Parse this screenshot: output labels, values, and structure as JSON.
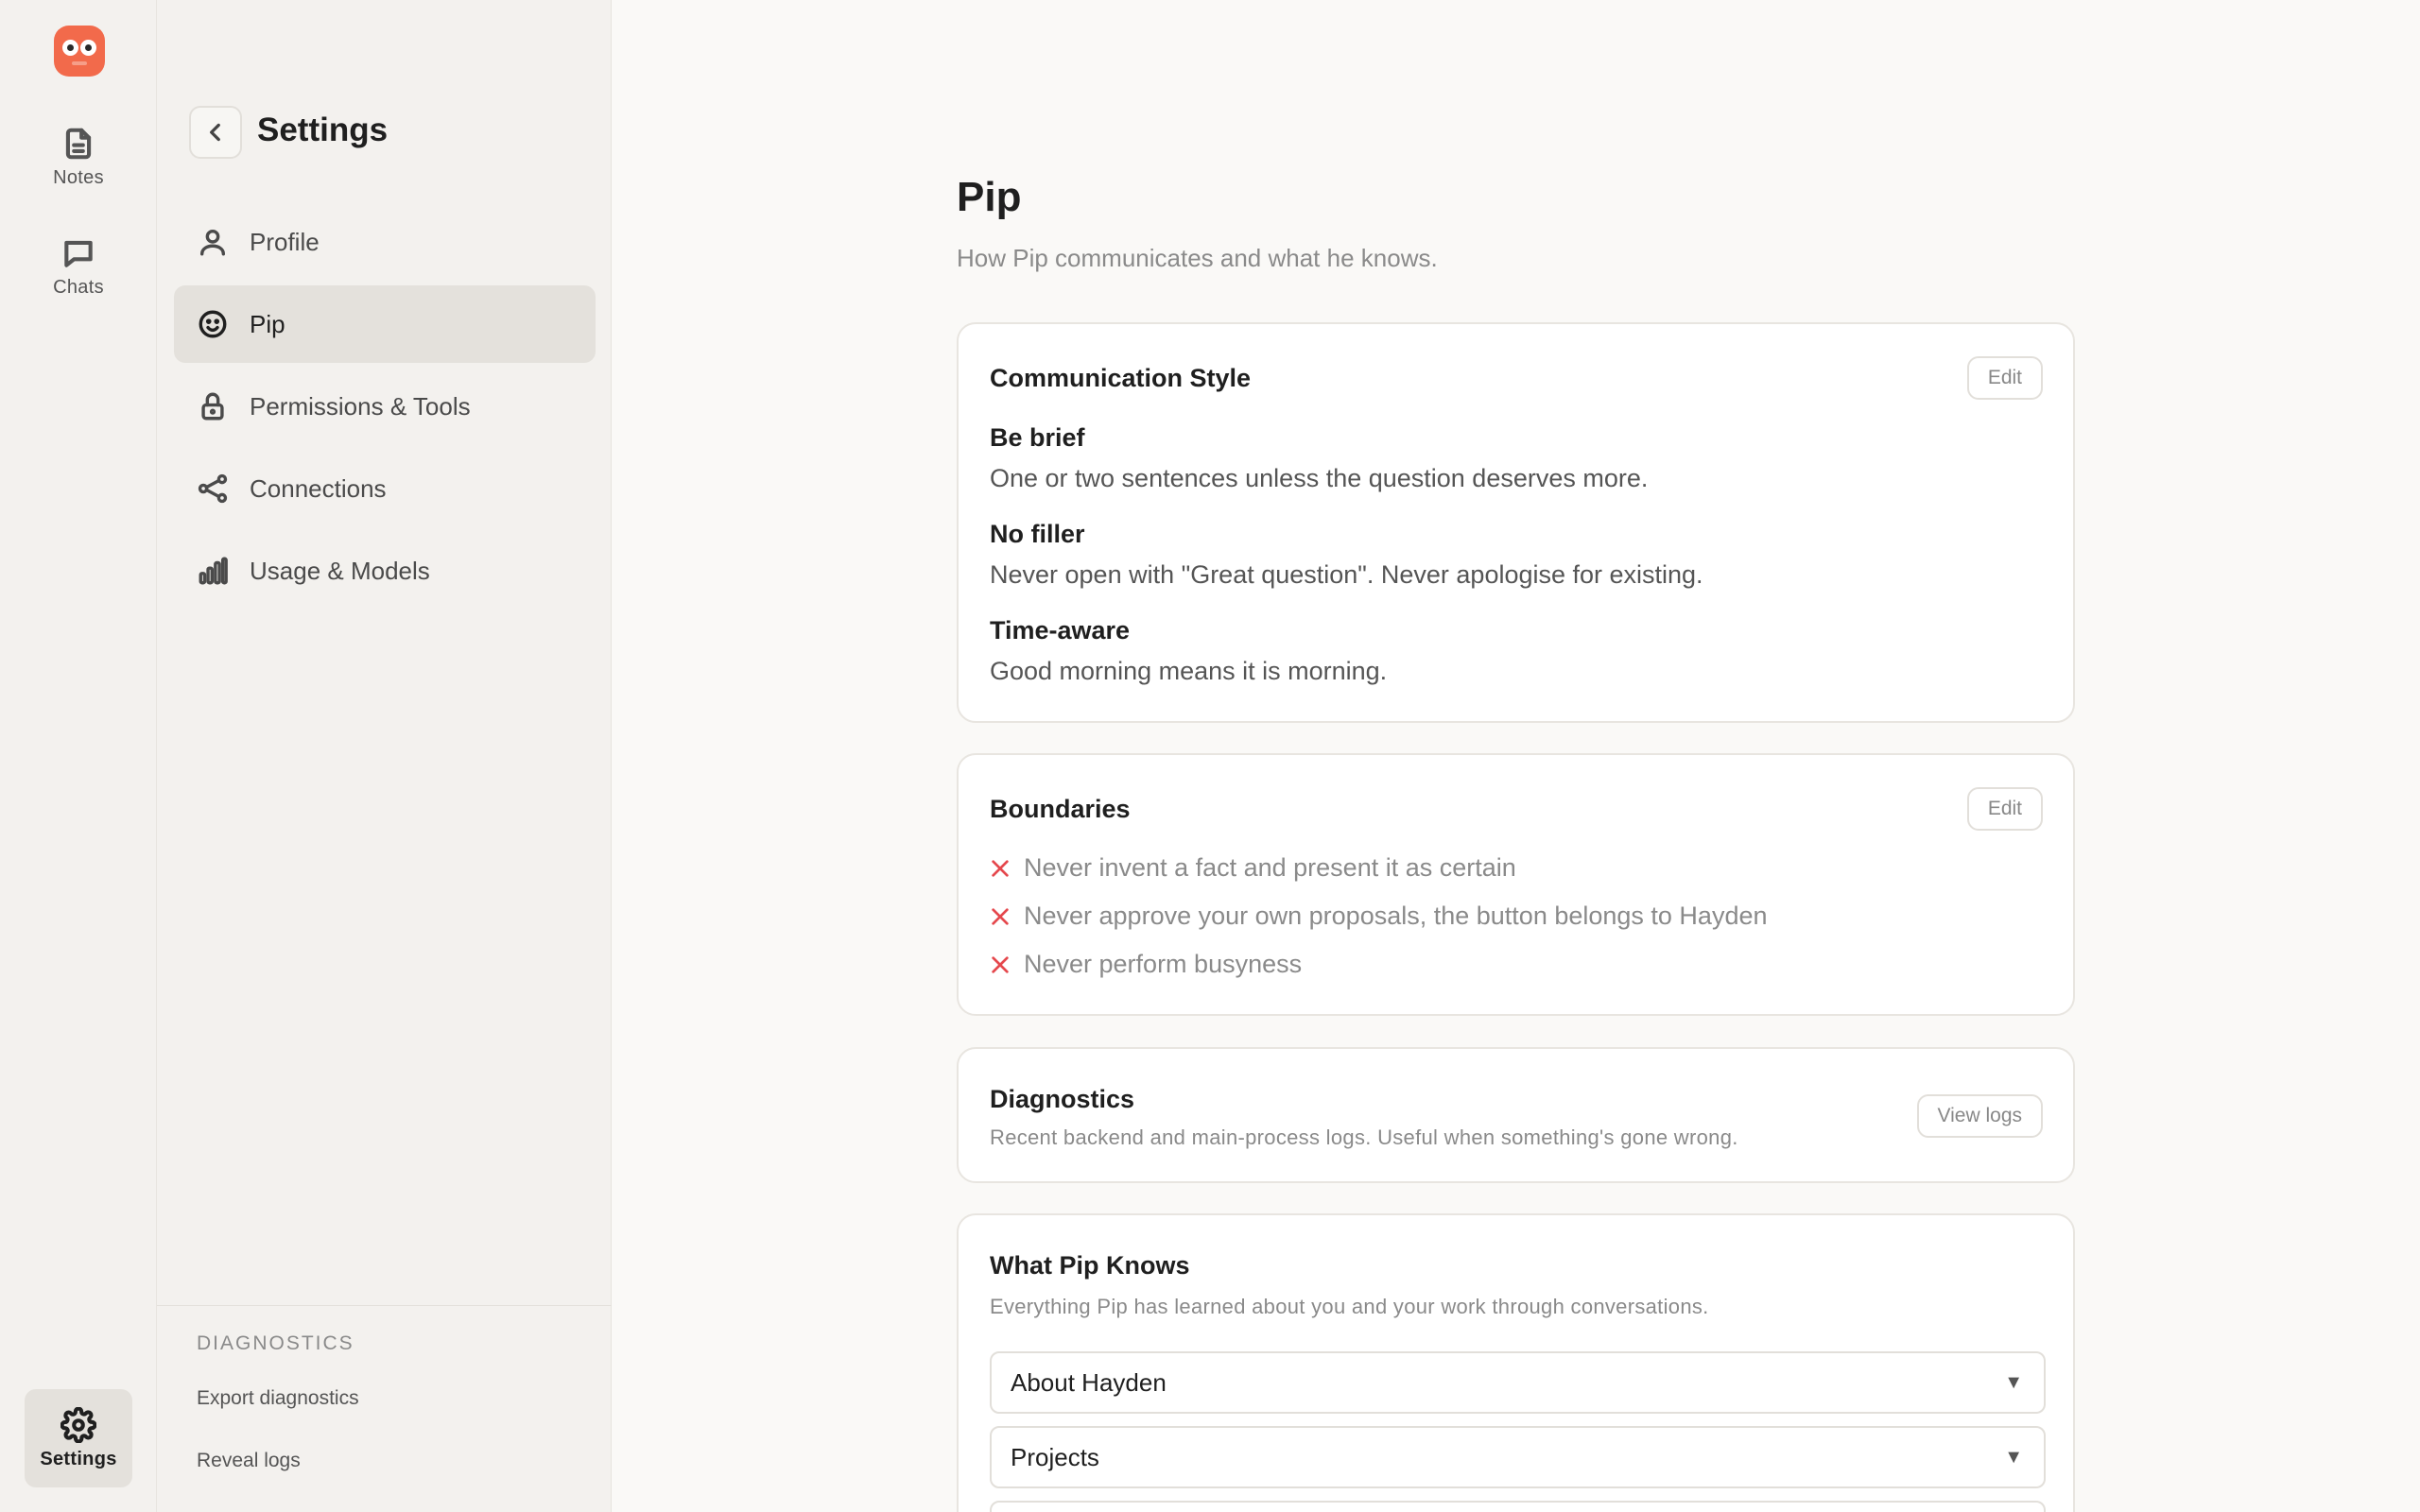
{
  "rail": {
    "items": [
      {
        "label": "Notes",
        "icon": "document-icon"
      },
      {
        "label": "Chats",
        "icon": "chat-bubble-icon"
      },
      {
        "label": "Settings",
        "icon": "gear-icon"
      }
    ],
    "logo_color": "#f26a4b"
  },
  "sidebar": {
    "title": "Settings",
    "items": [
      {
        "label": "Profile",
        "icon": "person-icon",
        "active": false
      },
      {
        "label": "Pip",
        "icon": "smiley-icon",
        "active": true
      },
      {
        "label": "Permissions & Tools",
        "icon": "lock-icon",
        "active": false
      },
      {
        "label": "Connections",
        "icon": "share-nodes-icon",
        "active": false
      },
      {
        "label": "Usage & Models",
        "icon": "bar-chart-icon",
        "active": false
      }
    ],
    "diagnostics": {
      "heading": "DIAGNOSTICS",
      "export": "Export diagnostics",
      "reveal": "Reveal logs"
    }
  },
  "main": {
    "title": "Pip",
    "subtitle": "How Pip communicates and what he knows.",
    "communication": {
      "title": "Communication Style",
      "edit": "Edit",
      "rules": [
        {
          "title": "Be brief",
          "desc": "One or two sentences unless the question deserves more."
        },
        {
          "title": "No filler",
          "desc": "Never open with \"Great question\". Never apologise for existing."
        },
        {
          "title": "Time-aware",
          "desc": "Good morning means it is morning."
        }
      ]
    },
    "boundaries": {
      "title": "Boundaries",
      "edit": "Edit",
      "items": [
        "Never invent a fact and present it as certain",
        "Never approve your own proposals, the button belongs to Hayden",
        "Never perform busyness"
      ],
      "icon_color": "#e5484d"
    },
    "diagnostics": {
      "title": "Diagnostics",
      "desc": "Recent backend and main-process logs. Useful when something's gone wrong.",
      "button": "View logs"
    },
    "knows": {
      "title": "What Pip Knows",
      "desc": "Everything Pip has learned about you and your work through conversations.",
      "sections": [
        "About Hayden",
        "Projects",
        ""
      ]
    }
  }
}
